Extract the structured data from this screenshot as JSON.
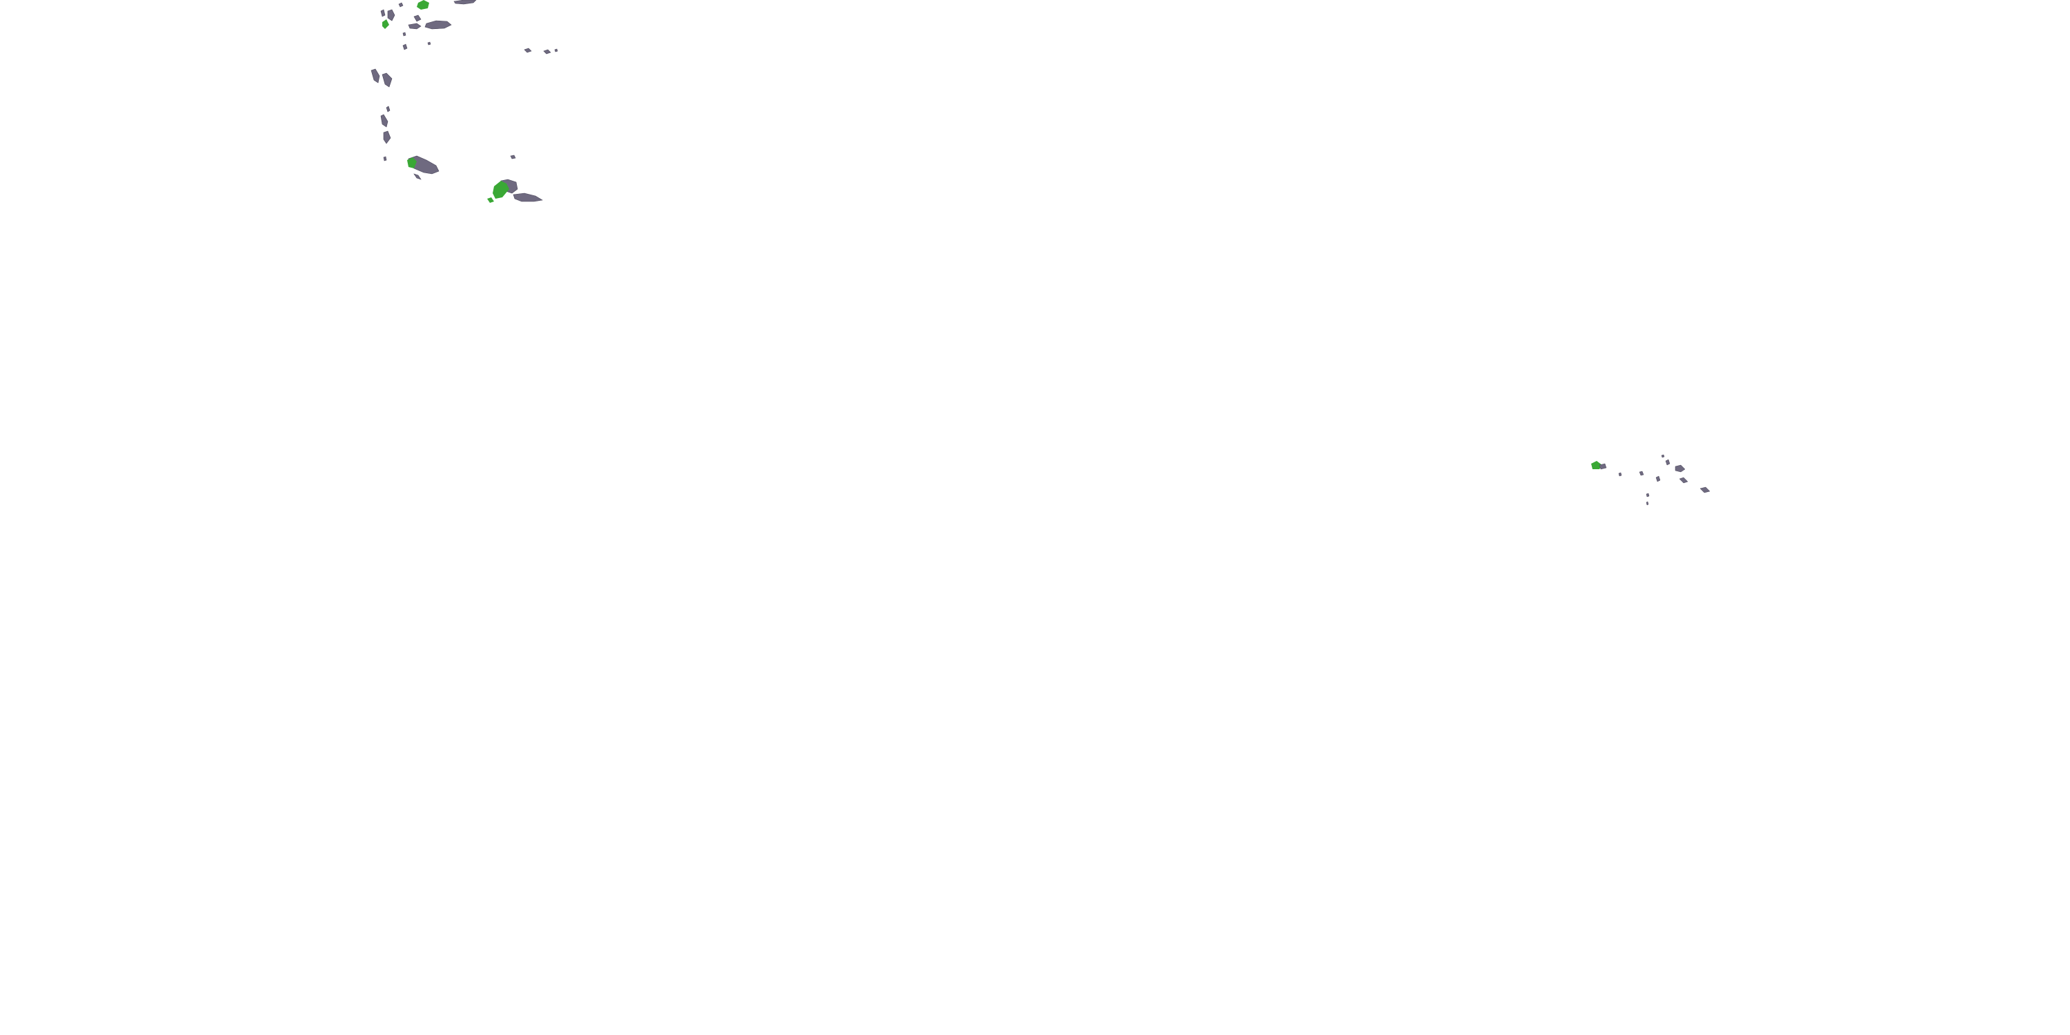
{
  "map": {
    "background_color": "#ffffff",
    "land_colors": {
      "gray": "#6f6a80",
      "green": "#3aa835",
      "outline": "#4a465a"
    },
    "regions": [
      {
        "name": "island-cluster-northwest",
        "color": "gray"
      },
      {
        "name": "island-cluster-northwest-vegetation",
        "color": "green"
      },
      {
        "name": "island-chain-west",
        "color": "gray"
      },
      {
        "name": "island-group-central-west",
        "color": "gray"
      },
      {
        "name": "island-group-central-west-vegetation",
        "color": "green"
      },
      {
        "name": "island-group-east",
        "color": "gray"
      },
      {
        "name": "island-group-east-vegetation",
        "color": "green"
      },
      {
        "name": "scattered-islets-northeast",
        "color": "gray"
      }
    ]
  }
}
